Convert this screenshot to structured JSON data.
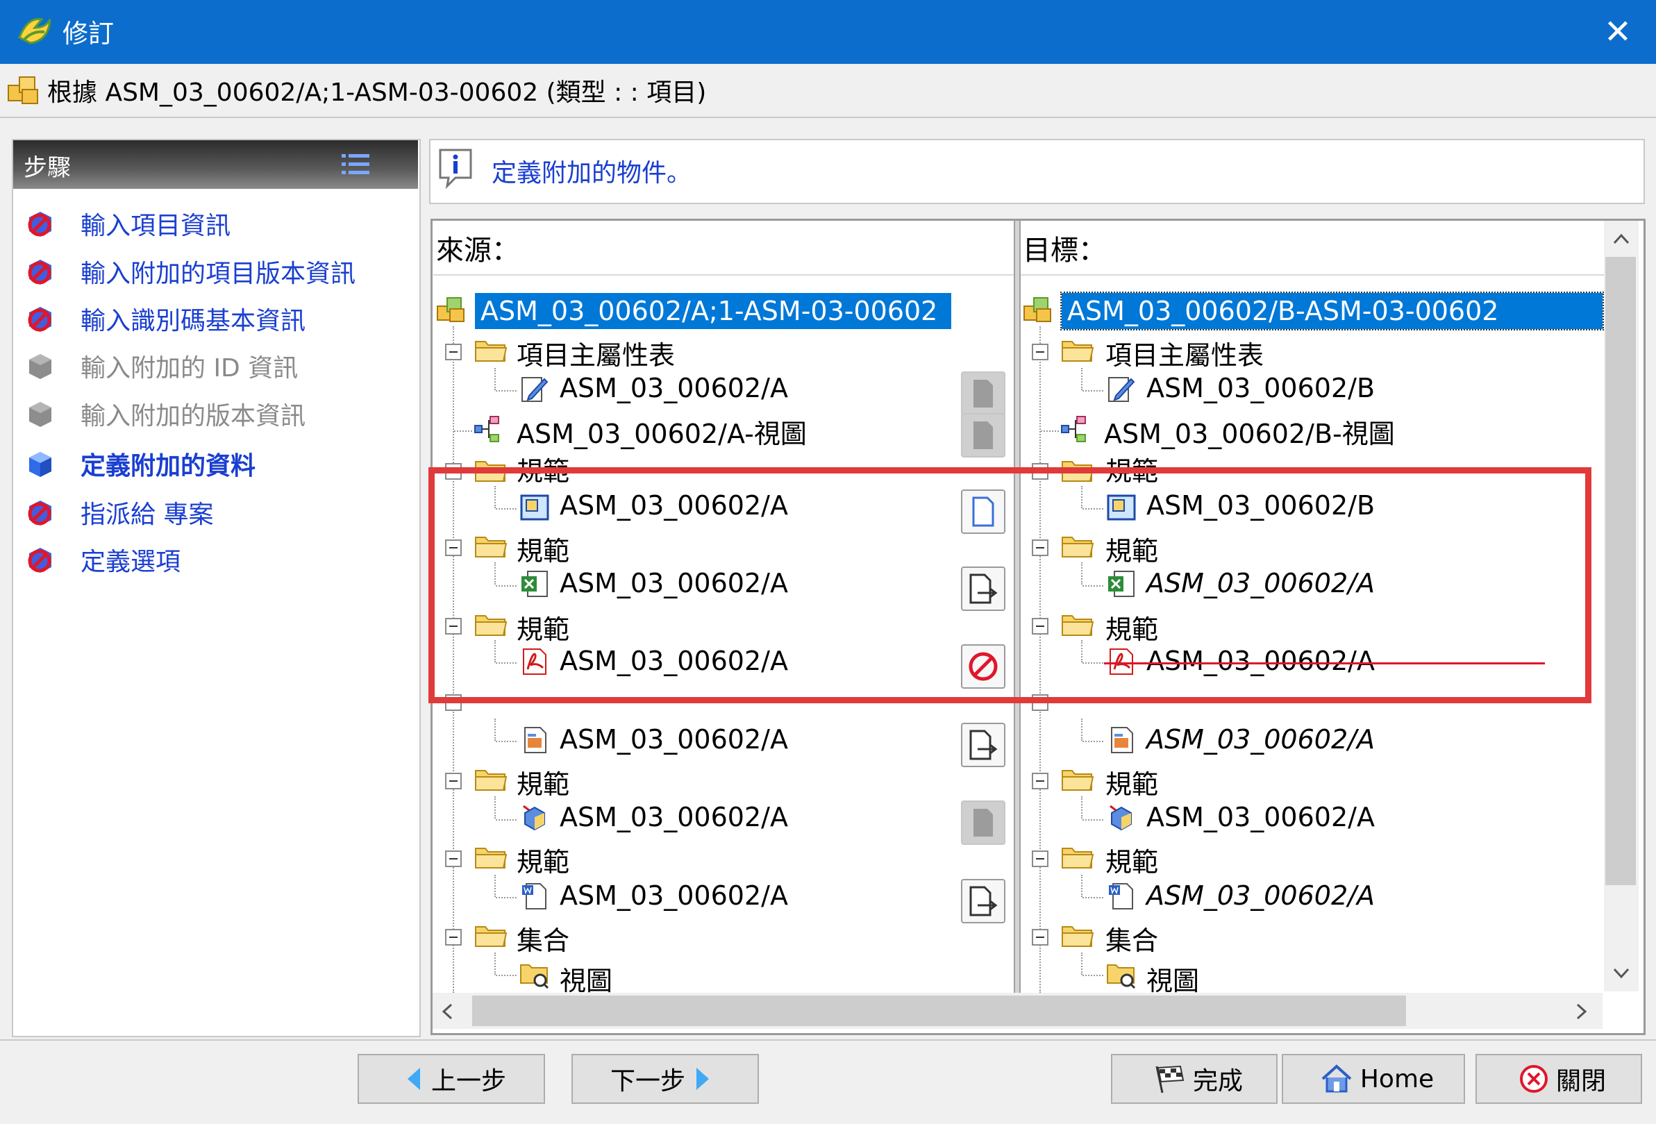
{
  "window": {
    "title": "修訂",
    "close_label": "✕"
  },
  "header": {
    "text": "根據 ASM_03_00602/A;1-ASM-03-00602 (類型 : : 項目)"
  },
  "steps": {
    "title": "步驟",
    "items": [
      {
        "label": "輸入項目資訊",
        "state": "active"
      },
      {
        "label": "輸入附加的項目版本資訊",
        "state": "active"
      },
      {
        "label": "輸入識別碼基本資訊",
        "state": "active"
      },
      {
        "label": "輸入附加的 ID 資訊",
        "state": "inactive"
      },
      {
        "label": "輸入附加的版本資訊",
        "state": "inactive"
      },
      {
        "label": "定義附加的資料",
        "state": "current"
      },
      {
        "label": "指派給 專案",
        "state": "active"
      },
      {
        "label": "定義選項",
        "state": "active"
      }
    ]
  },
  "info": {
    "text": "定義附加的物件。"
  },
  "source": {
    "title": "來源：",
    "root": "ASM_03_00602/A;1-ASM-03-00602",
    "master_folder": "項目主屬性表",
    "master_item": "ASM_03_00602/A",
    "view": "ASM_03_00602/A-視圖",
    "spec_folder_label": "規範",
    "spec_items": [
      "ASM_03_00602/A",
      "ASM_03_00602/A",
      "ASM_03_00602/A",
      "ASM_03_00602/A",
      "ASM_03_00602/A",
      "ASM_03_00602/A"
    ],
    "collection_folder": "集合",
    "collection_item": "視圖"
  },
  "target": {
    "title": "目標：",
    "root": "ASM_03_00602/B-ASM-03-00602",
    "master_folder": "項目主屬性表",
    "master_item": "ASM_03_00602/B",
    "view": "ASM_03_00602/B-視圖",
    "spec_folder_label": "規範",
    "spec_items": [
      "ASM_03_00602/B",
      "ASM_03_00602/A",
      "ASM_03_00602/A",
      "ASM_03_00602/A",
      "ASM_03_00602/A",
      "ASM_03_00602/A"
    ],
    "collection_folder": "集合",
    "collection_item": "視圖"
  },
  "actions": [
    "disabled",
    "disabled",
    "copy",
    "reference",
    "no-copy",
    "reference",
    "disabled",
    "reference"
  ],
  "buttons": {
    "back": "上一步",
    "next": "下一步",
    "finish": "完成",
    "home": "Home",
    "close": "關閉"
  },
  "colors": {
    "titlebar": "#0c6dcc",
    "link": "#1a3fd0",
    "highlight": "#e03a3a",
    "selection": "#0078d7"
  }
}
